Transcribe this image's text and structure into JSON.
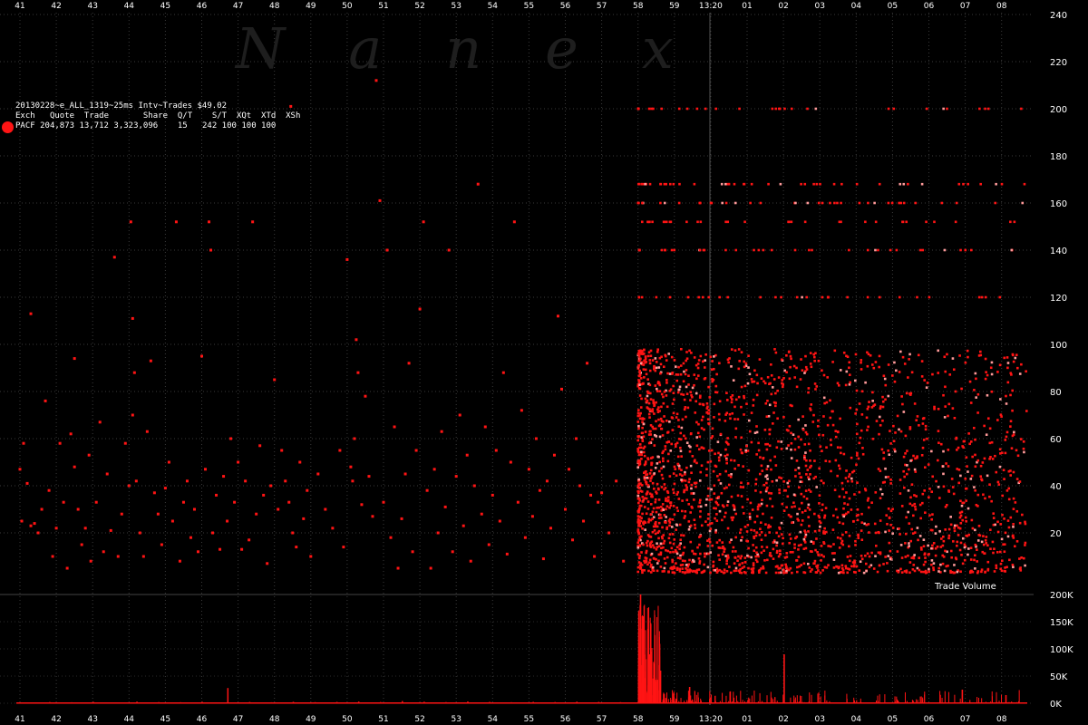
{
  "chart_data": [
    {
      "type": "scatter",
      "title": "20130228~e_ALL_1319~25ms Intv~Trades $49.02",
      "watermark": "Nanex",
      "xlabel": "",
      "ylabel": "",
      "x_tick_labels": [
        "41",
        "42",
        "43",
        "44",
        "45",
        "46",
        "47",
        "48",
        "49",
        "50",
        "51",
        "52",
        "53",
        "54",
        "55",
        "56",
        "57",
        "58",
        "59",
        "13:20",
        "01",
        "02",
        "03",
        "04",
        "05",
        "06",
        "07",
        "08"
      ],
      "y_ticks": [
        20,
        40,
        60,
        80,
        100,
        120,
        140,
        160,
        180,
        200,
        220,
        240
      ],
      "ylim": [
        0,
        245
      ],
      "grid": true,
      "legend_position": "top-left",
      "legend": {
        "header": [
          "Exch",
          "Quote",
          "Trade",
          "Share",
          "Q/T",
          "S/T",
          "XQt",
          "XTd",
          "XSh"
        ],
        "rows": [
          {
            "values": [
              "PACF",
              "204,873",
              "13,712",
              "3,323,096",
              "15",
              "242",
              "100",
              "100",
              "100"
            ],
            "color": "#ff1414"
          }
        ]
      },
      "series": [
        {
          "name": "PACF",
          "color": "#ff1414",
          "points": [
            [
              41.0,
              47
            ],
            [
              41.05,
              25
            ],
            [
              41.1,
              58
            ],
            [
              41.2,
              41
            ],
            [
              41.3,
              23
            ],
            [
              41.3,
              113
            ],
            [
              41.4,
              24
            ],
            [
              41.5,
              20
            ],
            [
              41.6,
              30
            ],
            [
              41.7,
              76
            ],
            [
              41.8,
              38
            ],
            [
              41.9,
              10
            ],
            [
              42.0,
              22
            ],
            [
              42.1,
              58
            ],
            [
              42.2,
              33
            ],
            [
              42.3,
              5
            ],
            [
              42.4,
              62
            ],
            [
              42.5,
              48
            ],
            [
              42.5,
              94
            ],
            [
              42.6,
              30
            ],
            [
              42.7,
              15
            ],
            [
              42.8,
              22
            ],
            [
              42.9,
              53
            ],
            [
              42.95,
              8
            ],
            [
              43.1,
              33
            ],
            [
              43.2,
              67
            ],
            [
              43.3,
              12
            ],
            [
              43.4,
              45
            ],
            [
              43.5,
              21
            ],
            [
              43.6,
              137
            ],
            [
              43.7,
              10
            ],
            [
              43.8,
              28
            ],
            [
              43.9,
              58
            ],
            [
              44.0,
              40
            ],
            [
              44.05,
              152
            ],
            [
              44.1,
              70
            ],
            [
              44.1,
              111
            ],
            [
              44.15,
              88
            ],
            [
              44.2,
              42
            ],
            [
              44.3,
              20
            ],
            [
              44.4,
              10
            ],
            [
              44.5,
              63
            ],
            [
              44.6,
              93
            ],
            [
              44.7,
              37
            ],
            [
              44.8,
              28
            ],
            [
              44.9,
              15
            ],
            [
              45.0,
              39
            ],
            [
              45.1,
              50
            ],
            [
              45.2,
              25
            ],
            [
              45.3,
              152
            ],
            [
              45.4,
              8
            ],
            [
              45.5,
              33
            ],
            [
              45.6,
              42
            ],
            [
              45.7,
              18
            ],
            [
              45.8,
              30
            ],
            [
              45.9,
              12
            ],
            [
              46.0,
              95
            ],
            [
              46.1,
              47
            ],
            [
              46.2,
              152
            ],
            [
              46.25,
              140
            ],
            [
              46.3,
              20
            ],
            [
              46.4,
              36
            ],
            [
              46.5,
              13
            ],
            [
              46.6,
              44
            ],
            [
              46.7,
              25
            ],
            [
              46.8,
              60
            ],
            [
              46.9,
              33
            ],
            [
              47.0,
              50
            ],
            [
              47.1,
              13
            ],
            [
              47.2,
              42
            ],
            [
              47.3,
              17
            ],
            [
              47.4,
              152
            ],
            [
              47.5,
              28
            ],
            [
              47.6,
              57
            ],
            [
              47.7,
              36
            ],
            [
              47.8,
              7
            ],
            [
              47.9,
              40
            ],
            [
              48.0,
              85
            ],
            [
              48.1,
              30
            ],
            [
              48.2,
              55
            ],
            [
              48.3,
              42
            ],
            [
              48.4,
              33
            ],
            [
              48.45,
              201
            ],
            [
              48.5,
              20
            ],
            [
              48.6,
              14
            ],
            [
              48.7,
              50
            ],
            [
              48.8,
              26
            ],
            [
              48.9,
              38
            ],
            [
              49.0,
              10
            ],
            [
              49.2,
              45
            ],
            [
              49.4,
              30
            ],
            [
              49.6,
              22
            ],
            [
              49.8,
              55
            ],
            [
              49.9,
              14
            ],
            [
              50.0,
              136
            ],
            [
              50.1,
              48
            ],
            [
              50.15,
              42
            ],
            [
              50.2,
              60
            ],
            [
              50.25,
              102
            ],
            [
              50.3,
              88
            ],
            [
              50.4,
              32
            ],
            [
              50.5,
              78
            ],
            [
              50.6,
              44
            ],
            [
              50.7,
              27
            ],
            [
              50.8,
              212
            ],
            [
              50.9,
              161
            ],
            [
              51.0,
              33
            ],
            [
              51.1,
              140
            ],
            [
              51.2,
              18
            ],
            [
              51.3,
              65
            ],
            [
              51.4,
              5
            ],
            [
              51.5,
              26
            ],
            [
              51.6,
              45
            ],
            [
              51.7,
              92
            ],
            [
              51.8,
              12
            ],
            [
              51.9,
              55
            ],
            [
              52.0,
              115
            ],
            [
              52.1,
              152
            ],
            [
              52.2,
              38
            ],
            [
              52.3,
              5
            ],
            [
              52.4,
              47
            ],
            [
              52.5,
              20
            ],
            [
              52.6,
              63
            ],
            [
              52.7,
              31
            ],
            [
              52.8,
              140
            ],
            [
              52.9,
              12
            ],
            [
              53.0,
              44
            ],
            [
              53.1,
              70
            ],
            [
              53.2,
              23
            ],
            [
              53.3,
              53
            ],
            [
              53.4,
              8
            ],
            [
              53.5,
              40
            ],
            [
              53.6,
              168
            ],
            [
              53.7,
              28
            ],
            [
              53.8,
              65
            ],
            [
              53.9,
              15
            ],
            [
              54.0,
              36
            ],
            [
              54.1,
              55
            ],
            [
              54.2,
              25
            ],
            [
              54.3,
              88
            ],
            [
              54.4,
              11
            ],
            [
              54.5,
              50
            ],
            [
              54.6,
              152
            ],
            [
              54.7,
              33
            ],
            [
              54.8,
              72
            ],
            [
              54.9,
              18
            ],
            [
              55.0,
              47
            ],
            [
              55.1,
              27
            ],
            [
              55.2,
              60
            ],
            [
              55.3,
              38
            ],
            [
              55.4,
              9
            ],
            [
              55.5,
              42
            ],
            [
              55.6,
              22
            ],
            [
              55.7,
              53
            ],
            [
              55.8,
              112
            ],
            [
              55.9,
              81
            ],
            [
              56.0,
              30
            ],
            [
              56.1,
              47
            ],
            [
              56.2,
              17
            ],
            [
              56.3,
              60
            ],
            [
              56.4,
              40
            ],
            [
              56.5,
              25
            ],
            [
              56.6,
              92
            ],
            [
              56.7,
              36
            ],
            [
              56.8,
              10
            ],
            [
              56.9,
              33
            ],
            [
              57.0,
              37
            ],
            [
              57.2,
              20
            ],
            [
              57.4,
              42
            ],
            [
              57.6,
              8
            ]
          ]
        }
      ]
    },
    {
      "type": "bar",
      "title": "Trade Volume",
      "y_tick_labels": [
        "200K",
        "150K",
        "100K",
        "50K",
        "0K"
      ],
      "ylim": [
        0,
        200000
      ],
      "color": "#ff1414",
      "values_note": "",
      "series": [
        {
          "name": "",
          "x": [
            41.2,
            41.8,
            42.4,
            43.0,
            43.6,
            44.2,
            44.8,
            45.4,
            46.0,
            46.7,
            47.3,
            47.9,
            48.5,
            49.1,
            49.7,
            50.3,
            50.9,
            51.5,
            52.1,
            52.7,
            53.3,
            53.9,
            54.5,
            55.1,
            55.7,
            56.3,
            56.9,
            57.5
          ],
          "values": [
            1500,
            2200,
            1800,
            2600,
            1400,
            3000,
            2100,
            1900,
            2500,
            28000,
            2300,
            1800,
            2700,
            2000,
            2400,
            3100,
            2200,
            4000,
            2800,
            2100,
            3300,
            2500,
            1900,
            2600,
            2200,
            2900,
            2400,
            2000
          ]
        }
      ]
    }
  ]
}
